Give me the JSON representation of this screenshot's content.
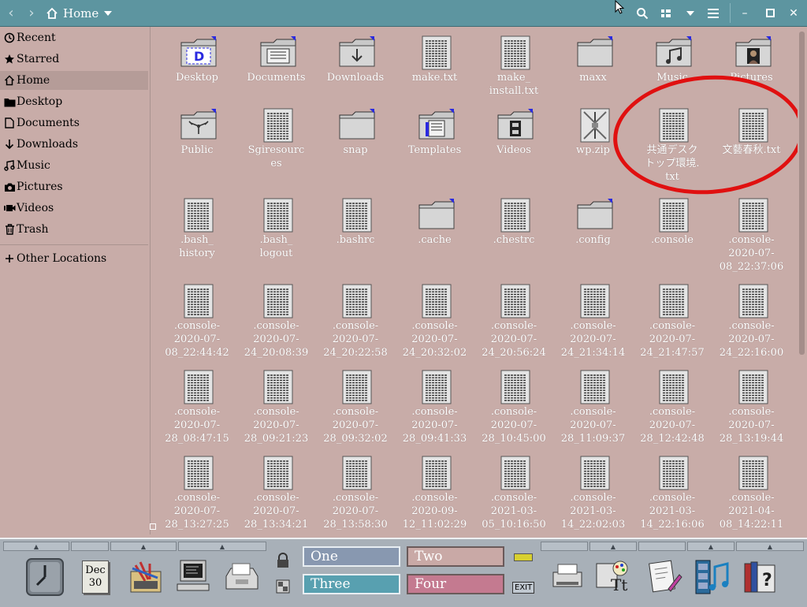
{
  "header": {
    "back_icon": "chevron-left-icon",
    "forward_icon": "chevron-right-icon",
    "location_label": "Home",
    "search_icon": "search-icon",
    "view_icon": "view-options-icon",
    "menu_icon": "hamburger-menu-icon",
    "minimize_label": "–",
    "maximize_label": "▫",
    "close_label": "✕"
  },
  "sidebar": {
    "items": [
      {
        "label": "Recent",
        "icon": "clock-icon"
      },
      {
        "label": "Starred",
        "icon": "star-icon"
      },
      {
        "label": "Home",
        "icon": "home-icon",
        "active": true
      },
      {
        "label": "Desktop",
        "icon": "folder-icon"
      },
      {
        "label": "Documents",
        "icon": "document-icon"
      },
      {
        "label": "Downloads",
        "icon": "download-icon"
      },
      {
        "label": "Music",
        "icon": "music-icon"
      },
      {
        "label": "Pictures",
        "icon": "camera-icon"
      },
      {
        "label": "Videos",
        "icon": "video-icon"
      },
      {
        "label": "Trash",
        "icon": "trash-icon"
      }
    ],
    "other_locations": "Other Locations"
  },
  "files": [
    {
      "name": "Desktop",
      "type": "folder-desktop"
    },
    {
      "name": "Documents",
      "type": "folder-documents"
    },
    {
      "name": "Downloads",
      "type": "folder-downloads"
    },
    {
      "name": "make.txt",
      "type": "text"
    },
    {
      "name": "make_\ninstall.txt",
      "type": "text"
    },
    {
      "name": "maxx",
      "type": "folder"
    },
    {
      "name": "Music",
      "type": "folder-music"
    },
    {
      "name": "Pictures",
      "type": "folder-pictures"
    },
    {
      "name": "Public",
      "type": "folder-public"
    },
    {
      "name": "Sgiresourc\nes",
      "type": "text"
    },
    {
      "name": "snap",
      "type": "folder"
    },
    {
      "name": "Templates",
      "type": "folder-templates"
    },
    {
      "name": "Videos",
      "type": "folder-videos"
    },
    {
      "name": "wp.zip",
      "type": "zip"
    },
    {
      "name": "共通デスク\nトップ環境.\ntxt",
      "type": "text"
    },
    {
      "name": "文藝春秋.txt",
      "type": "text"
    },
    {
      "name": ".bash_\nhistory",
      "type": "text"
    },
    {
      "name": ".bash_\nlogout",
      "type": "text"
    },
    {
      "name": ".bashrc",
      "type": "text"
    },
    {
      "name": ".cache",
      "type": "folder"
    },
    {
      "name": ".chestrc",
      "type": "text"
    },
    {
      "name": ".config",
      "type": "folder"
    },
    {
      "name": ".console",
      "type": "text"
    },
    {
      "name": ".console-\n2020-07-\n08_22:37:06",
      "type": "text"
    },
    {
      "name": ".console-\n2020-07-\n08_22:44:42",
      "type": "text"
    },
    {
      "name": ".console-\n2020-07-\n24_20:08:39",
      "type": "text"
    },
    {
      "name": ".console-\n2020-07-\n24_20:22:58",
      "type": "text"
    },
    {
      "name": ".console-\n2020-07-\n24_20:32:02",
      "type": "text"
    },
    {
      "name": ".console-\n2020-07-\n24_20:56:24",
      "type": "text"
    },
    {
      "name": ".console-\n2020-07-\n24_21:34:14",
      "type": "text"
    },
    {
      "name": ".console-\n2020-07-\n24_21:47:57",
      "type": "text"
    },
    {
      "name": ".console-\n2020-07-\n24_22:16:00",
      "type": "text"
    },
    {
      "name": ".console-\n2020-07-\n28_08:47:15",
      "type": "text"
    },
    {
      "name": ".console-\n2020-07-\n28_09:21:23",
      "type": "text"
    },
    {
      "name": ".console-\n2020-07-\n28_09:32:02",
      "type": "text"
    },
    {
      "name": ".console-\n2020-07-\n28_09:41:33",
      "type": "text"
    },
    {
      "name": ".console-\n2020-07-\n28_10:45:00",
      "type": "text"
    },
    {
      "name": ".console-\n2020-07-\n28_11:09:37",
      "type": "text"
    },
    {
      "name": ".console-\n2020-07-\n28_12:42:48",
      "type": "text"
    },
    {
      "name": ".console-\n2020-07-\n28_13:19:44",
      "type": "text"
    },
    {
      "name": ".console-\n2020-07-\n28_13:27:25",
      "type": "text"
    },
    {
      "name": ".console-\n2020-07-\n28_13:34:21",
      "type": "text"
    },
    {
      "name": ".console-\n2020-07-\n28_13:58:30",
      "type": "text"
    },
    {
      "name": ".console-\n2020-09-\n12_11:02:29",
      "type": "text"
    },
    {
      "name": ".console-\n2021-03-\n05_10:16:50",
      "type": "text"
    },
    {
      "name": ".console-\n2021-03-\n14_22:02:03",
      "type": "text"
    },
    {
      "name": ".console-\n2021-03-\n14_22:16:06",
      "type": "text"
    },
    {
      "name": ".console-\n2021-04-\n08_14:22:11",
      "type": "text"
    }
  ],
  "panel": {
    "calendar_month": "Dec",
    "calendar_day": "30",
    "workspaces": [
      {
        "label": "One",
        "color": "#8898b0"
      },
      {
        "label": "Two",
        "color": "#c9a9a6"
      },
      {
        "label": "Three",
        "color": "#58a0b0"
      },
      {
        "label": "Four",
        "color": "#c47a90"
      }
    ],
    "exit_label": "EXIT",
    "help_label": "?"
  },
  "colors": {
    "background": "#c8aca8",
    "header": "#5d95a0",
    "annotation": "#e01010"
  }
}
